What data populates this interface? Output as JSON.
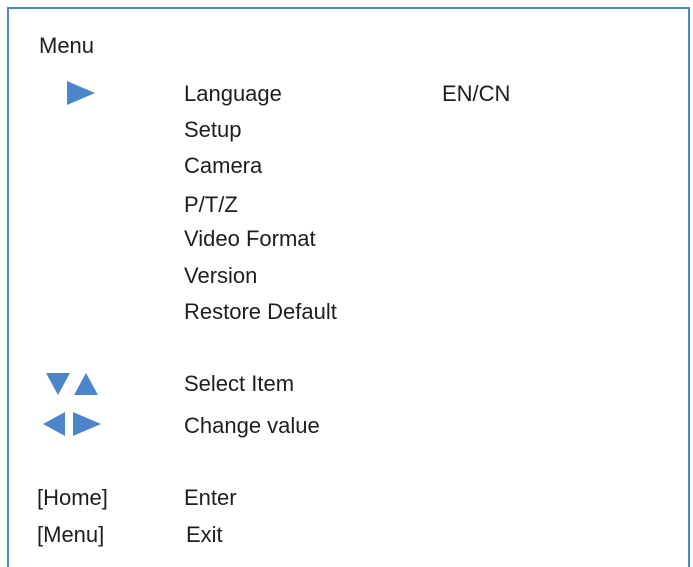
{
  "menu": {
    "title": "Menu",
    "items": [
      {
        "label": "Language",
        "value": "EN/CN"
      },
      {
        "label": "Setup",
        "value": ""
      },
      {
        "label": "Camera",
        "value": ""
      },
      {
        "label": "P/T/Z",
        "value": ""
      },
      {
        "label": "Video Format",
        "value": ""
      },
      {
        "label": "Version",
        "value": ""
      },
      {
        "label": "Restore Default",
        "value": ""
      }
    ],
    "selected_icon": "right-arrow-icon"
  },
  "help": {
    "select_item": "Select Item",
    "change_value": "Change value",
    "home_key": "[Home]",
    "home_action": "Enter",
    "menu_key": "[Menu]",
    "menu_action": "Exit"
  },
  "colors": {
    "border": "#4a86c9",
    "icon": "#4a86c9",
    "text": "#1e1e1e",
    "background": "#ffffff"
  }
}
